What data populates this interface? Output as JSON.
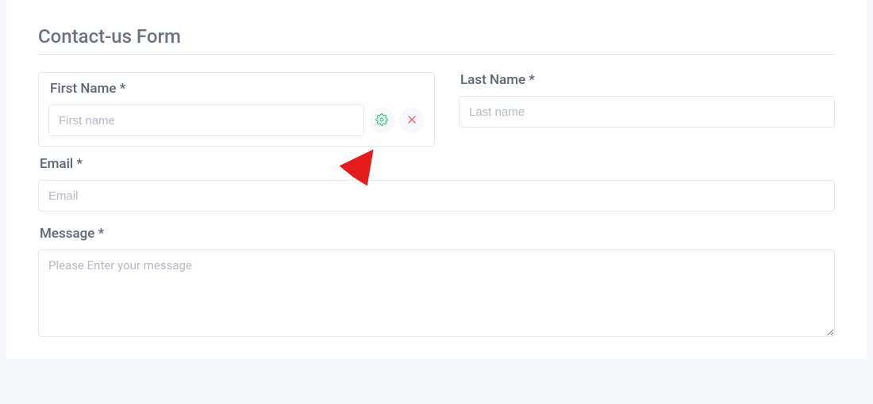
{
  "form": {
    "title": "Contact-us Form",
    "fields": {
      "first_name": {
        "label": "First Name *",
        "placeholder": "First name"
      },
      "last_name": {
        "label": "Last Name *",
        "placeholder": "Last name"
      },
      "email": {
        "label": "Email *",
        "placeholder": "Email"
      },
      "message": {
        "label": "Message *",
        "placeholder": "Please Enter your message"
      }
    }
  }
}
